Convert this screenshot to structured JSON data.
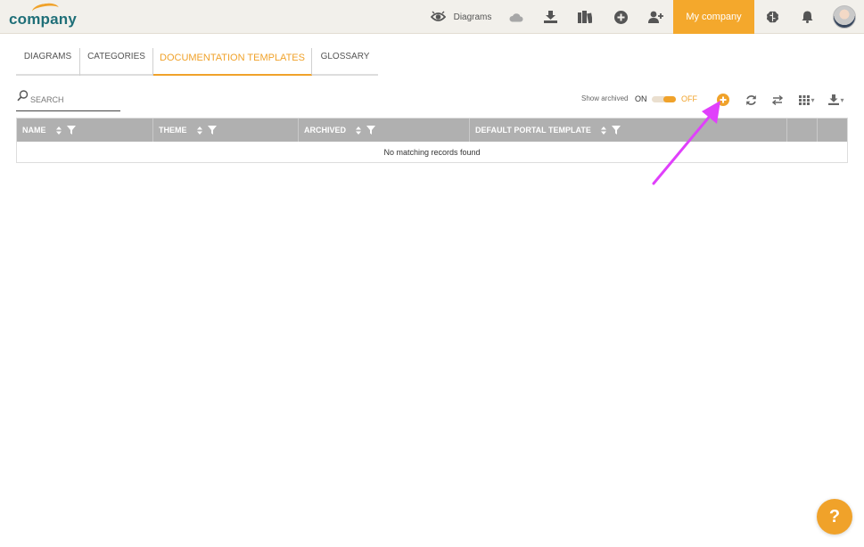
{
  "header": {
    "logo": "company",
    "nav_diagrams": "Diagrams",
    "my_company": "My company",
    "icons": [
      "eye-icon",
      "cloud-icon",
      "download-icon",
      "book-icon",
      "plus-circle-icon",
      "add-user-icon",
      "brain-icon",
      "bell-icon"
    ]
  },
  "tabs": [
    {
      "label": "DIAGRAMS"
    },
    {
      "label": "CATEGORIES"
    },
    {
      "label": "DOCUMENTATION TEMPLATES",
      "active": true
    },
    {
      "label": "GLOSSARY"
    }
  ],
  "search": {
    "placeholder": "SEARCH"
  },
  "toolbar": {
    "show_archived_label": "Show archived",
    "on_label": "ON",
    "off_label": "OFF",
    "toggle_state": "OFF"
  },
  "table": {
    "columns": [
      {
        "label": "NAME"
      },
      {
        "label": "THEME"
      },
      {
        "label": "ARCHIVED"
      },
      {
        "label": "DEFAULT PORTAL TEMPLATE"
      }
    ],
    "empty_message": "No matching records found"
  },
  "help_label": "?",
  "colors": {
    "accent": "#f0a22a",
    "logo": "#1f6f78",
    "header_bg": "#f2f0eb",
    "table_header": "#b0b0b0",
    "annotation_arrow": "#e040fb"
  }
}
